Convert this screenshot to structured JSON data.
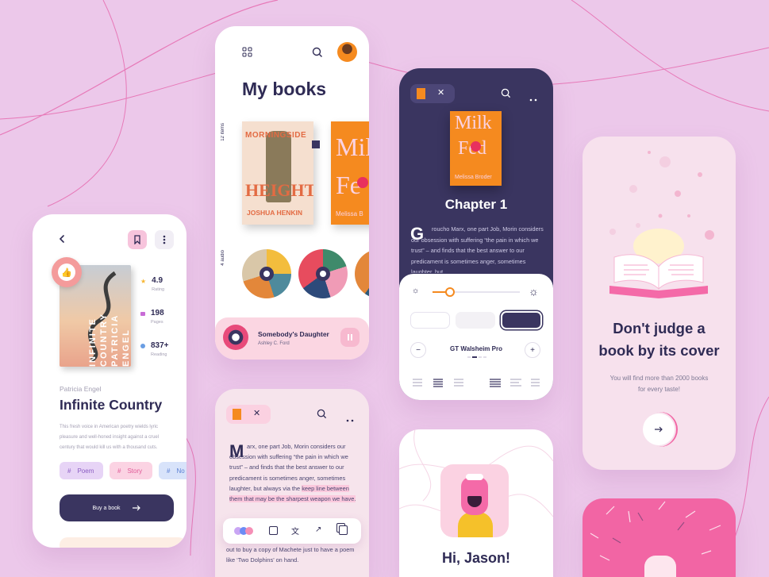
{
  "colors": {
    "background": "#ecc8ea",
    "navy": "#3a3560",
    "pink": "#f265a4",
    "orange": "#f58a1f",
    "peach": "#f7d6df"
  },
  "detail": {
    "badge_back": "BESTSELLER",
    "cover_words": [
      "INFINITE",
      "COUNTRY",
      "PATRICIA",
      "ENGEL"
    ],
    "stats": [
      {
        "value": "4.9",
        "label": "Rating",
        "icon": "star-icon"
      },
      {
        "value": "198",
        "label": "Pages",
        "icon": "pages-icon"
      },
      {
        "value": "837+",
        "label": "Reading",
        "icon": "user-icon"
      }
    ],
    "author": "Patricia Engel",
    "title": "Infinite Country",
    "description": "This fresh voice in American poetry wields lyric pleasure and well-honed insight against a cruel century that would kill us with a thousand cuts.",
    "tags": [
      "Poem",
      "Story",
      "No"
    ],
    "buy_label": "Buy a book"
  },
  "library": {
    "title": "My books",
    "items_count": "12 items",
    "audio_count": "4 audio",
    "book1_lines": [
      "MORNINGSIDE",
      "HEIGHTS",
      "JOSHUA HENKIN"
    ],
    "book2_lines": [
      "Mil",
      "Fe",
      "Melissa B"
    ],
    "player": {
      "title": "Somebody's Daughter",
      "author": "Ashley C. Ford"
    }
  },
  "reader": {
    "cover_lines": [
      "Milk",
      "Fed",
      "Melissa Broder"
    ],
    "chapter": "Chapter 1",
    "dropcap": "G",
    "text": "roucho Marx, one part Job, Morin considers our obsession with suffering “the pain in which we trust” – and finds that the best answer to our predicament is sometimes anger, sometimes laughter, but",
    "brightness": 0.2,
    "font_name": "GT Walsheim Pro",
    "minus": "−",
    "plus": "+"
  },
  "onboarding": {
    "heading": "Don't judge a book by its cover",
    "subtitle": "You will find more than 2000 books for every taste!"
  },
  "reading": {
    "dropcap": "M",
    "text_before": "arx, one part Job, Morin considers our obsession with suffering “the pain in which we trust” – and finds that the best answer to our predicament is sometimes anger, sometimes laughter, but always via the ",
    "highlight": "keep line between them that may be the sharpest weapon we have.",
    "text_after": "out to buy a copy of Machete just to have a poem like ‘Two Dolphins’ on hand."
  },
  "greeting": {
    "text": "Hi, Jason!"
  }
}
